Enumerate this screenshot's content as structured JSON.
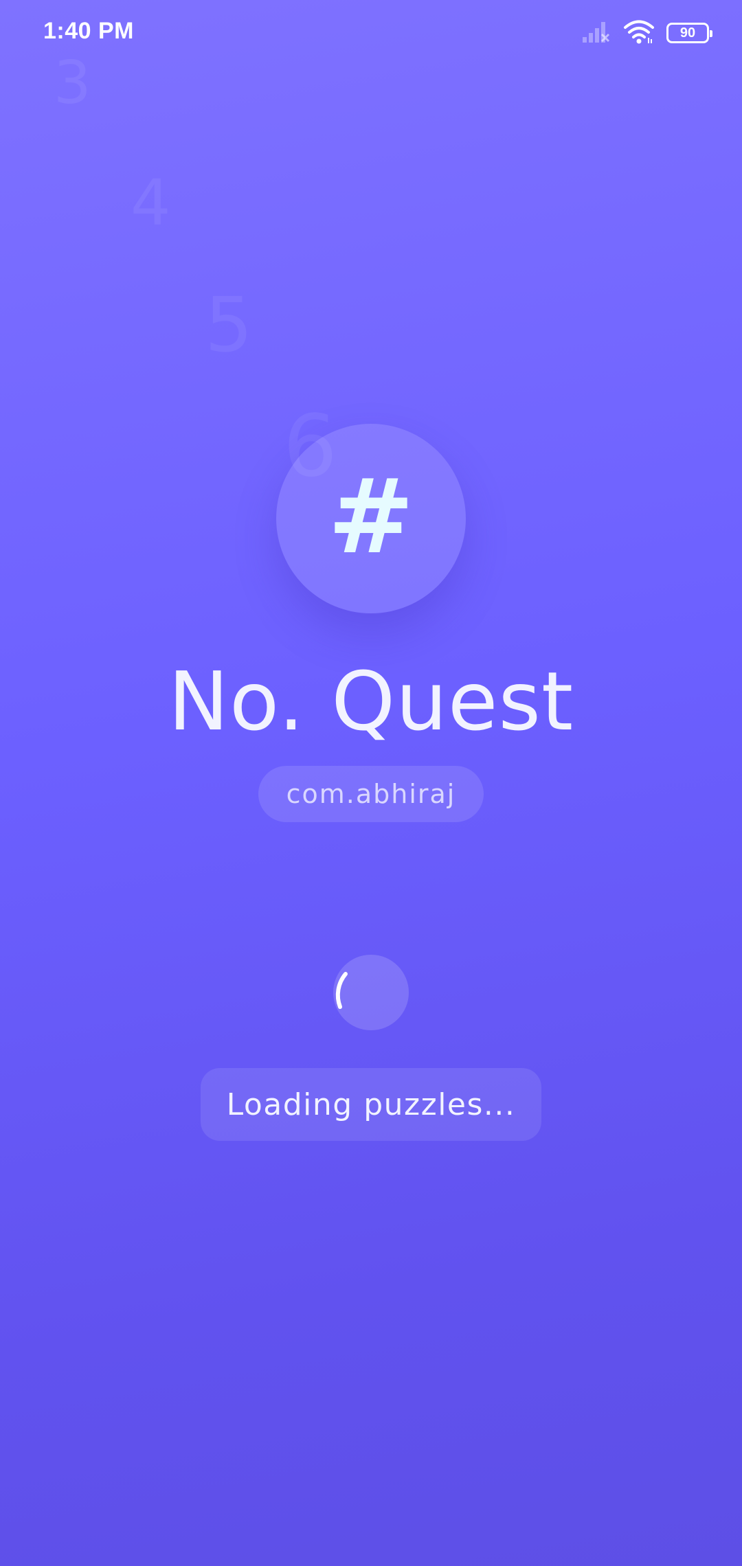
{
  "status_bar": {
    "time": "1:40 PM",
    "battery_level": "90",
    "icons": [
      "signal-icon",
      "wifi-icon",
      "battery-icon"
    ]
  },
  "background_numbers": [
    "3",
    "4",
    "5",
    "6"
  ],
  "logo": {
    "glyph": "#",
    "icon": "hash-icon"
  },
  "app": {
    "title": "No. Quest",
    "package": "com.abhiraj"
  },
  "loading": {
    "text": "Loading puzzles..."
  },
  "colors": {
    "background_top": "#7f72ff",
    "background_bottom": "#5d4fe6",
    "text": "#ffffff"
  }
}
